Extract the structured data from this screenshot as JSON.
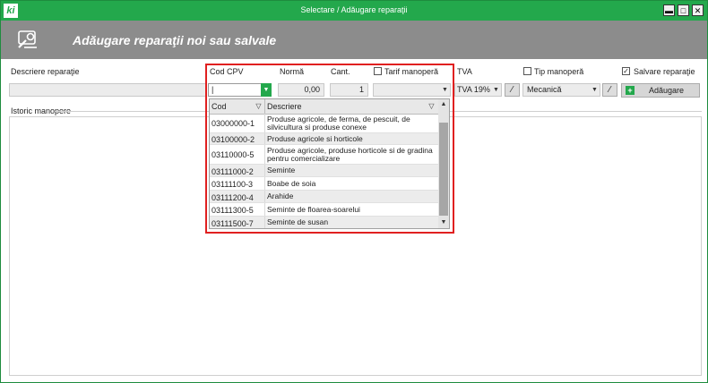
{
  "window": {
    "title": "Selectare / Adăugare reparaţii",
    "logo": "ki",
    "controls": {
      "minimize": "▬",
      "maximize": "□",
      "close": "✕"
    }
  },
  "header": {
    "title": "Adăugare reparaţii noi sau salvale",
    "icon": "repair-tools-icon"
  },
  "form": {
    "descriere_label": "Descriere reparaţie",
    "cod_cpv_label": "Cod CPV",
    "norma_label": "Normă",
    "cant_label": "Cant.",
    "tarif_label": "Tarif manoperă",
    "tva_label": "TVA",
    "tip_label": "Tip manoperă",
    "salvare_label": "Salvare reparaţie",
    "salvare_checked": "✓",
    "cod_cpv_value": "|",
    "norma_value": "0,00",
    "cant_value": "1",
    "tva_value": "TVA 19%",
    "tip_value": "Mecanică",
    "add_button": "Adăugare"
  },
  "history": {
    "label": "Istoric manopere"
  },
  "dropdown": {
    "columns": {
      "cod": "Cod",
      "descriere": "Descriere"
    },
    "rows": [
      {
        "cod": "03000000-1",
        "descriere": "Produse agricole, de ferma, de pescuit, de silvicultura si produse conexe"
      },
      {
        "cod": "03100000-2",
        "descriere": "Produse agricole si horticole"
      },
      {
        "cod": "03110000-5",
        "descriere": "Produse agricole, produse horticole si de gradina pentru comercializare"
      },
      {
        "cod": "03111000-2",
        "descriere": "Seminte"
      },
      {
        "cod": "03111100-3",
        "descriere": "Boabe de soia"
      },
      {
        "cod": "03111200-4",
        "descriere": "Arahide"
      },
      {
        "cod": "03111300-5",
        "descriere": "Seminte de floarea-soarelui"
      },
      {
        "cod": "03111500-7",
        "descriere": "Seminte de susan"
      }
    ]
  },
  "colors": {
    "accent": "#23a84c",
    "header": "#8c8c8c",
    "highlight": "#e02020"
  }
}
